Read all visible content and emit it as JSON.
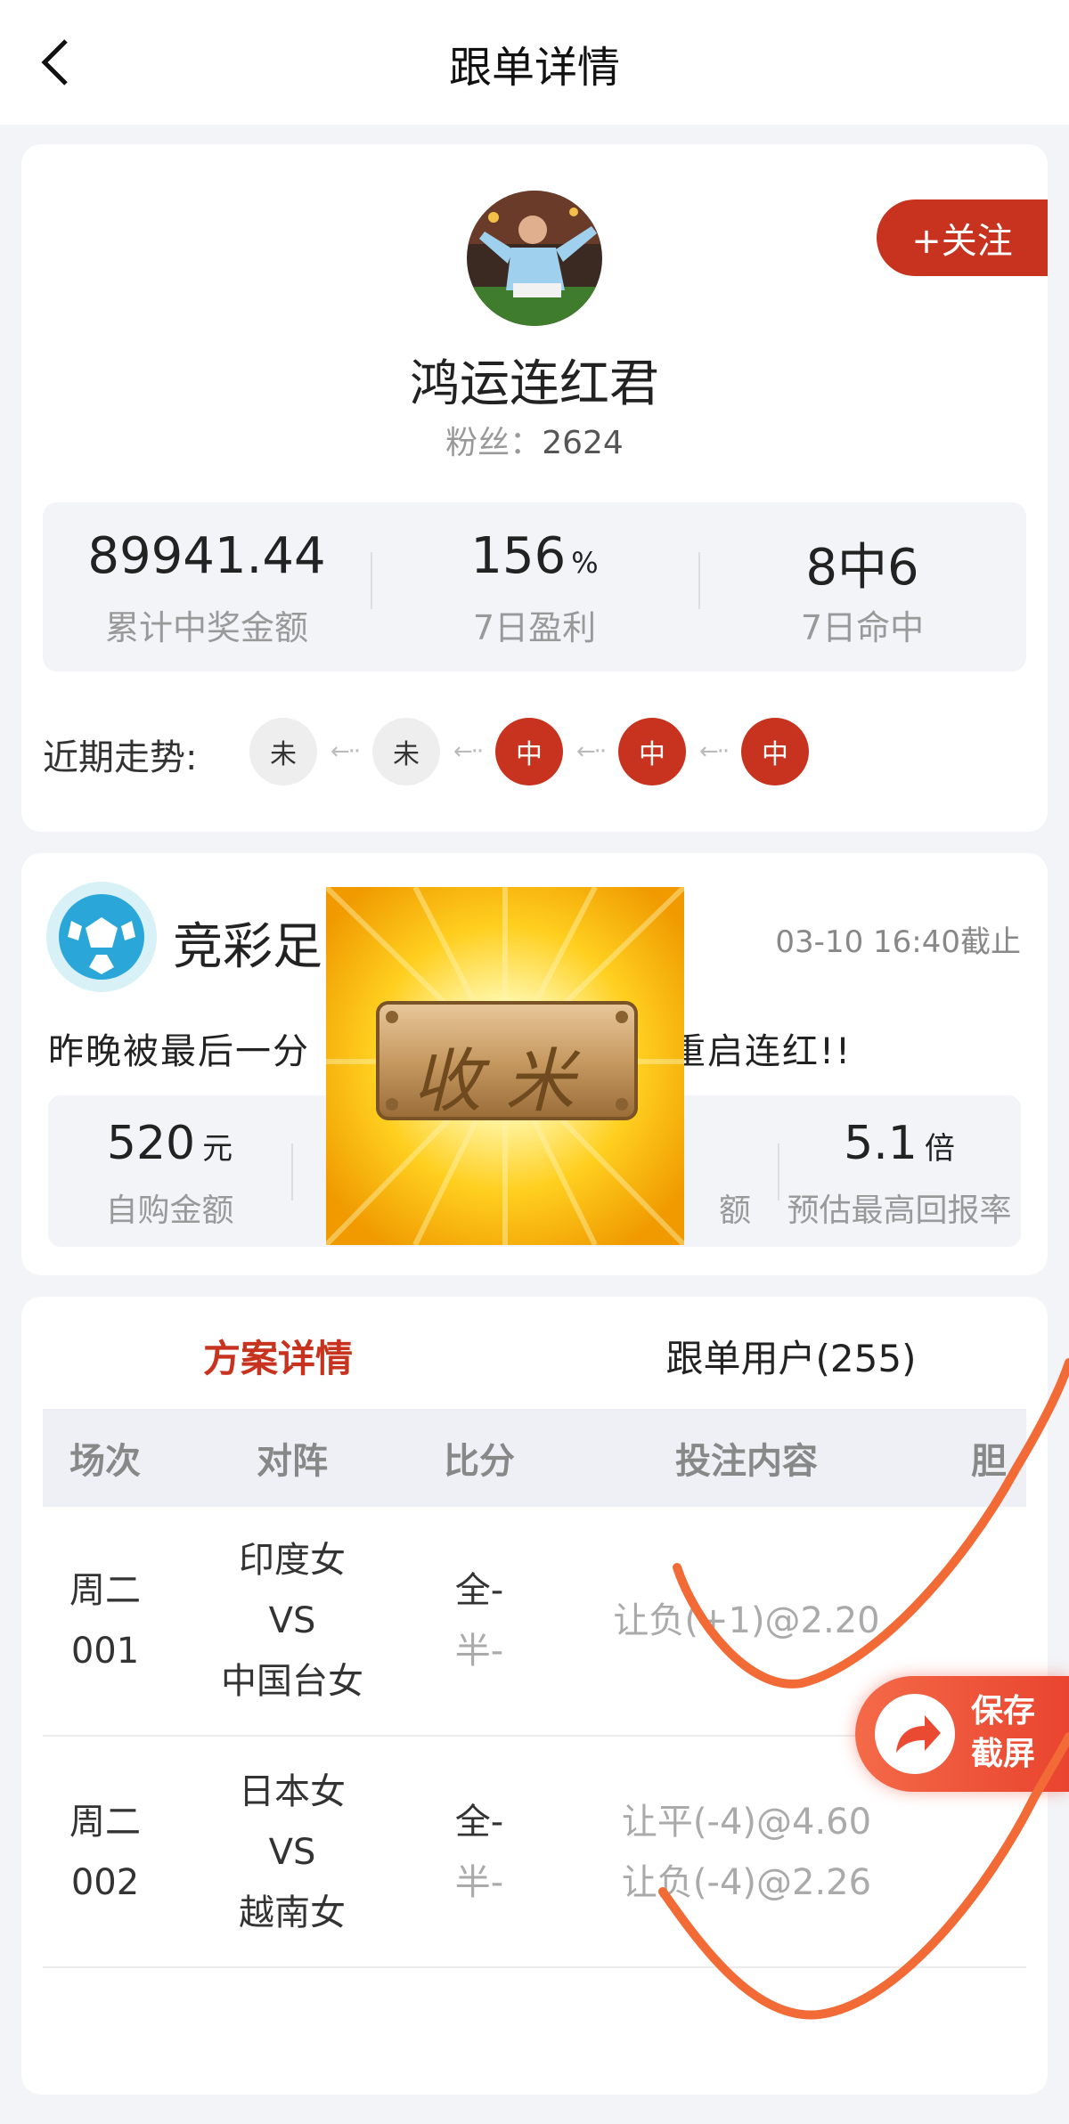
{
  "nav": {
    "title": "跟单详情"
  },
  "profile": {
    "follow_label": "+关注",
    "name": "鸿运连红君",
    "fans_label": "粉丝：",
    "fans_count": "2624",
    "stats": [
      {
        "value": "89941.44",
        "unit": "",
        "label": "累计中奖金额"
      },
      {
        "value": "156",
        "unit": "%",
        "label": "7日盈利"
      },
      {
        "value": "8中6",
        "unit": "",
        "label": "7日命中"
      }
    ],
    "trend_label": "近期走势:",
    "trend": [
      {
        "text": "未",
        "status": "miss"
      },
      {
        "text": "未",
        "status": "miss"
      },
      {
        "text": "中",
        "status": "hit"
      },
      {
        "text": "中",
        "status": "hit"
      },
      {
        "text": "中",
        "status": "hit"
      }
    ],
    "trend_arrow": "←··"
  },
  "plan": {
    "title": "竞彩足",
    "deadline": "03-10 16:40截止",
    "description_start": "昨晚被最后一分",
    "description_end": "重启连红!!",
    "stats": [
      {
        "value": "520",
        "unit": "元",
        "label": "自购金额"
      },
      {
        "value": "",
        "unit": "",
        "label": ""
      },
      {
        "value": "",
        "unit": "",
        "label": "额"
      },
      {
        "value": "5.1",
        "unit": "倍",
        "label": "预估最高回报率"
      }
    ],
    "overlay_text": "收米"
  },
  "detail": {
    "tabs": [
      {
        "label": "方案详情",
        "active": true
      },
      {
        "label": "跟单用户(255)",
        "active": false
      }
    ],
    "columns": [
      "场次",
      "对阵",
      "比分",
      "投注内容",
      "胆"
    ],
    "rows": [
      {
        "match_day": "周二",
        "match_no": "001",
        "home": "印度女",
        "vs": "VS",
        "away": "中国台女",
        "full": "全-",
        "half": "半-",
        "bets": [
          "让负(+1)@2.20"
        ]
      },
      {
        "match_day": "周二",
        "match_no": "002",
        "home": "日本女",
        "vs": "VS",
        "away": "越南女",
        "full": "全-",
        "half": "半-",
        "bets": [
          "让平(-4)@4.60",
          "让负(-4)@2.26"
        ]
      }
    ]
  },
  "save_button": {
    "line1": "保存",
    "line2": "截屏"
  },
  "colors": {
    "accent": "#c7331f",
    "background": "#f3f4f8",
    "scribble": "#f26a36"
  }
}
